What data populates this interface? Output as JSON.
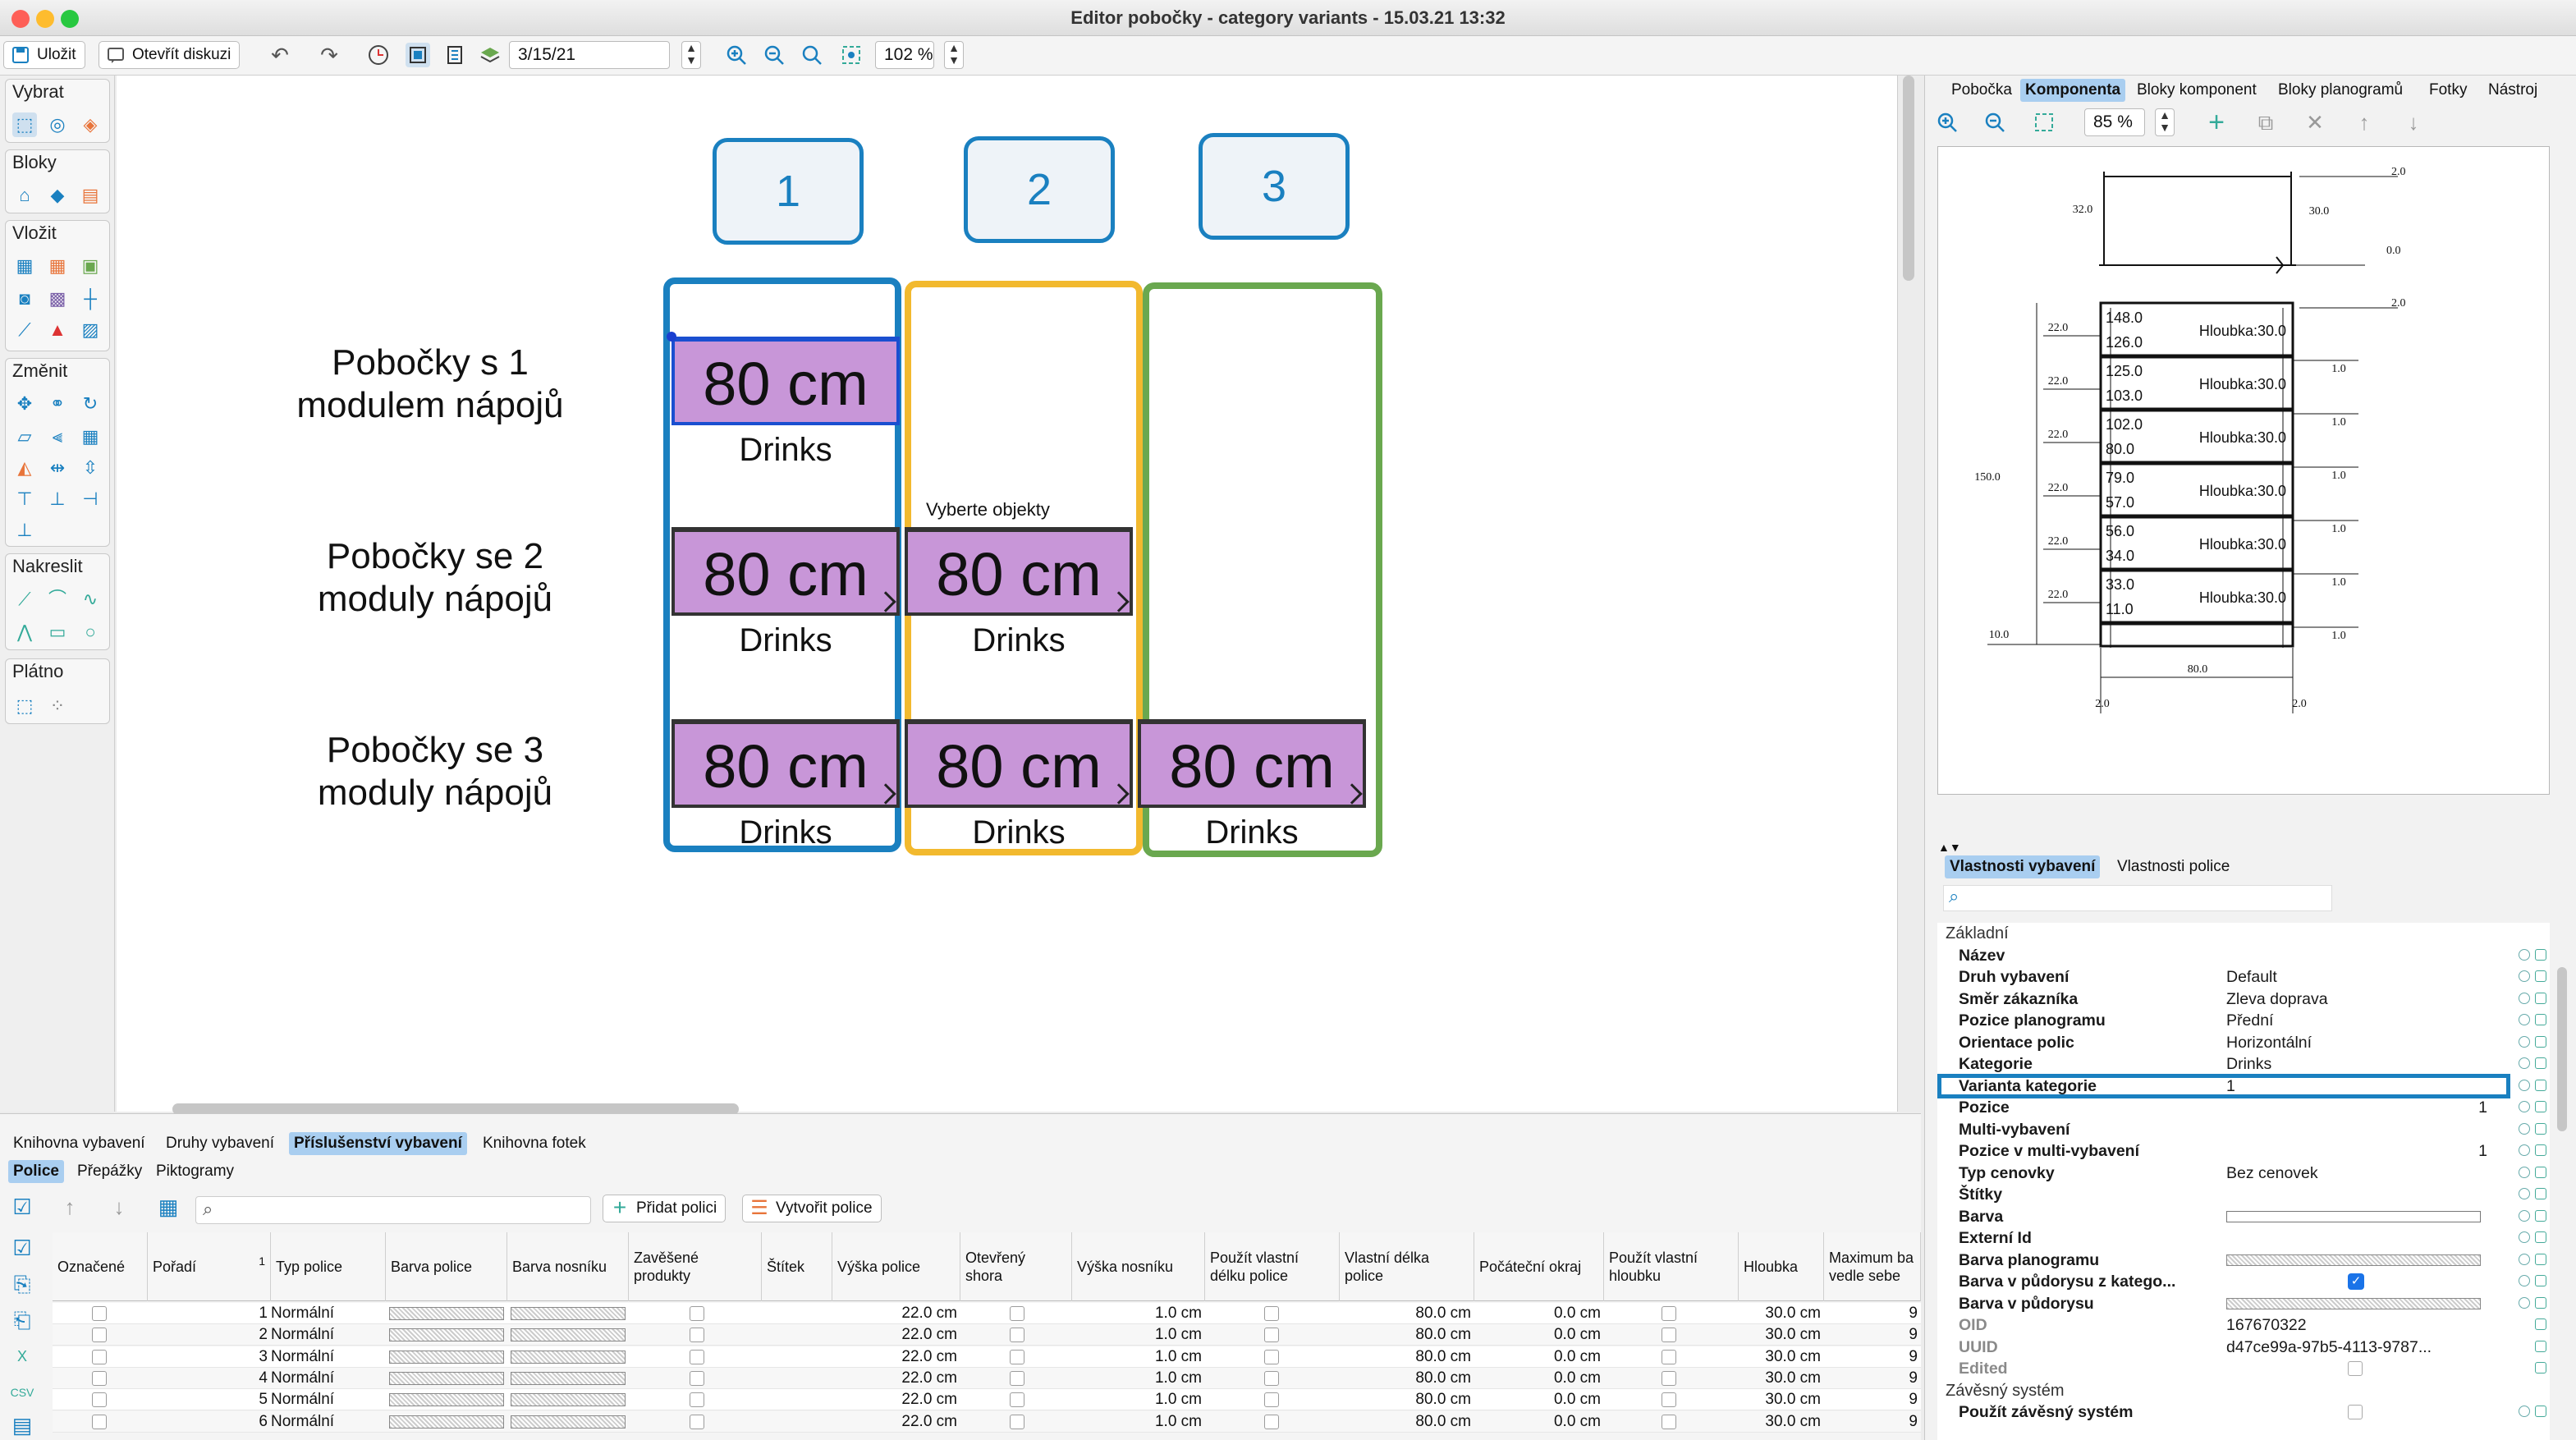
{
  "window": {
    "title": "Editor pobočky - category variants - 15.03.21 13:32"
  },
  "toolbar": {
    "save": "Uložit",
    "discussion": "Otevřít diskuzi",
    "date": "3/15/21",
    "zoom": "102 %"
  },
  "tools": {
    "groups": [
      "Vybrat",
      "Bloky",
      "Vložit",
      "Změnit",
      "Nakreslit",
      "Plátno"
    ]
  },
  "canvas": {
    "columns": [
      "1",
      "2",
      "3"
    ],
    "rows": [
      {
        "label_line1": "Pobočky s 1",
        "label_line2": "modulem nápojů"
      },
      {
        "label_line1": "Pobočky se 2",
        "label_line2": "moduly nápojů"
      },
      {
        "label_line1": "Pobočky se 3",
        "label_line2": "moduly nápojů"
      }
    ],
    "module_length": "80 cm",
    "module_category": "Drinks",
    "tooltip": "Vyberte objekty",
    "colors": {
      "col1": "#1a80c0",
      "col2": "#f2b92e",
      "col3": "#6aa84f",
      "shelf": "#c896d8"
    }
  },
  "bottom": {
    "tabs": [
      "Knihovna vybavení",
      "Druhy vybavení",
      "Příslušenství vybavení",
      "Knihovna fotek"
    ],
    "subtabs": [
      "Police",
      "Přepážky",
      "Piktogramy"
    ],
    "add_shelf": "Přidat polici",
    "create_shelf": "Vytvořit police",
    "headers": [
      "Označené",
      "Pořadí",
      "Typ police",
      "Barva police",
      "Barva nosníku",
      "Zavěšené produkty",
      "Štítek",
      "Výška police",
      "Otevřený shora",
      "Výška nosníku",
      "Použít vlastní délku police",
      "Vlastní délka police",
      "Počáteční okraj",
      "Použít vlastní hloubku",
      "Hloubka",
      "Maximum ba vedle sebe"
    ],
    "sort_indicator": "1",
    "rows": [
      {
        "order": "1",
        "type": "Normální",
        "height": "22.0 cm",
        "beam": "1.0 cm",
        "length": "80.0 cm",
        "margin": "0.0 cm",
        "depth": "30.0 cm",
        "max": "9"
      },
      {
        "order": "2",
        "type": "Normální",
        "height": "22.0 cm",
        "beam": "1.0 cm",
        "length": "80.0 cm",
        "margin": "0.0 cm",
        "depth": "30.0 cm",
        "max": "9"
      },
      {
        "order": "3",
        "type": "Normální",
        "height": "22.0 cm",
        "beam": "1.0 cm",
        "length": "80.0 cm",
        "margin": "0.0 cm",
        "depth": "30.0 cm",
        "max": "9"
      },
      {
        "order": "4",
        "type": "Normální",
        "height": "22.0 cm",
        "beam": "1.0 cm",
        "length": "80.0 cm",
        "margin": "0.0 cm",
        "depth": "30.0 cm",
        "max": "9"
      },
      {
        "order": "5",
        "type": "Normální",
        "height": "22.0 cm",
        "beam": "1.0 cm",
        "length": "80.0 cm",
        "margin": "0.0 cm",
        "depth": "30.0 cm",
        "max": "9"
      },
      {
        "order": "6",
        "type": "Normální",
        "height": "22.0 cm",
        "beam": "1.0 cm",
        "length": "80.0 cm",
        "margin": "0.0 cm",
        "depth": "30.0 cm",
        "max": "9"
      }
    ]
  },
  "right": {
    "tabs": [
      "Pobočka",
      "Komponenta",
      "Bloky komponent",
      "Bloky planogramů",
      "Fotky",
      "Nástroj"
    ],
    "zoom": "85 %",
    "preview": {
      "top_dims": [
        "2.0",
        "32.0",
        "30.0",
        "0.0",
        "2.0"
      ],
      "shelves": [
        {
          "top": "148.0",
          "bottom": "126.0",
          "depth": "Hloubka:30.0",
          "left": "22.0",
          "right": "1.0"
        },
        {
          "top": "125.0",
          "bottom": "103.0",
          "depth": "Hloubka:30.0",
          "left": "22.0",
          "right": "1.0"
        },
        {
          "top": "102.0",
          "bottom": "80.0",
          "depth": "Hloubka:30.0",
          "left": "22.0",
          "right": "1.0"
        },
        {
          "top": "79.0",
          "bottom": "57.0",
          "depth": "Hloubka:30.0",
          "left": "22.0",
          "right": "1.0"
        },
        {
          "top": "56.0",
          "bottom": "34.0",
          "depth": "Hloubka:30.0",
          "left": "22.0",
          "right": "1.0"
        },
        {
          "top": "33.0",
          "bottom": "11.0",
          "depth": "Hloubka:30.0",
          "left": "22.0",
          "right": "1.0"
        }
      ],
      "height": "150.0",
      "base": "10.0",
      "width": "80.0",
      "foot_left": "2.0",
      "foot_right": "2.0"
    },
    "prop_tabs": [
      "Vlastnosti vybavení",
      "Vlastnosti police"
    ],
    "sections": {
      "basic": "Základní",
      "hanging": "Závěsný systém"
    },
    "props": [
      {
        "name": "Název",
        "value": ""
      },
      {
        "name": "Druh vybavení",
        "value": "Default"
      },
      {
        "name": "Směr zákazníka",
        "value": "Zleva doprava"
      },
      {
        "name": "Pozice planogramu",
        "value": "Přední"
      },
      {
        "name": "Orientace polic",
        "value": "Horizontální"
      },
      {
        "name": "Kategorie",
        "value": "Drinks"
      },
      {
        "name": "Varianta kategorie",
        "value": "1"
      },
      {
        "name": "Pozice",
        "value": "1"
      },
      {
        "name": "Multi-vybavení",
        "value": ""
      },
      {
        "name": "Pozice v multi-vybavení",
        "value": "1"
      },
      {
        "name": "Typ cenovky",
        "value": "Bez cenovek"
      },
      {
        "name": "Štítky",
        "value": ""
      },
      {
        "name": "Barva",
        "value": ""
      },
      {
        "name": "Externí Id",
        "value": ""
      },
      {
        "name": "Barva planogramu",
        "value": ""
      },
      {
        "name": "Barva v půdorysu z katego...",
        "value": ""
      },
      {
        "name": "Barva v půdorysu",
        "value": ""
      },
      {
        "name": "OID",
        "value": "167670322"
      },
      {
        "name": "UUID",
        "value": "d47ce99a-97b5-4113-9787..."
      },
      {
        "name": "Edited",
        "value": ""
      }
    ],
    "hanging_props": [
      {
        "name": "Použít závěsný systém",
        "value": ""
      }
    ],
    "highlight_color": "#1a80c0"
  }
}
